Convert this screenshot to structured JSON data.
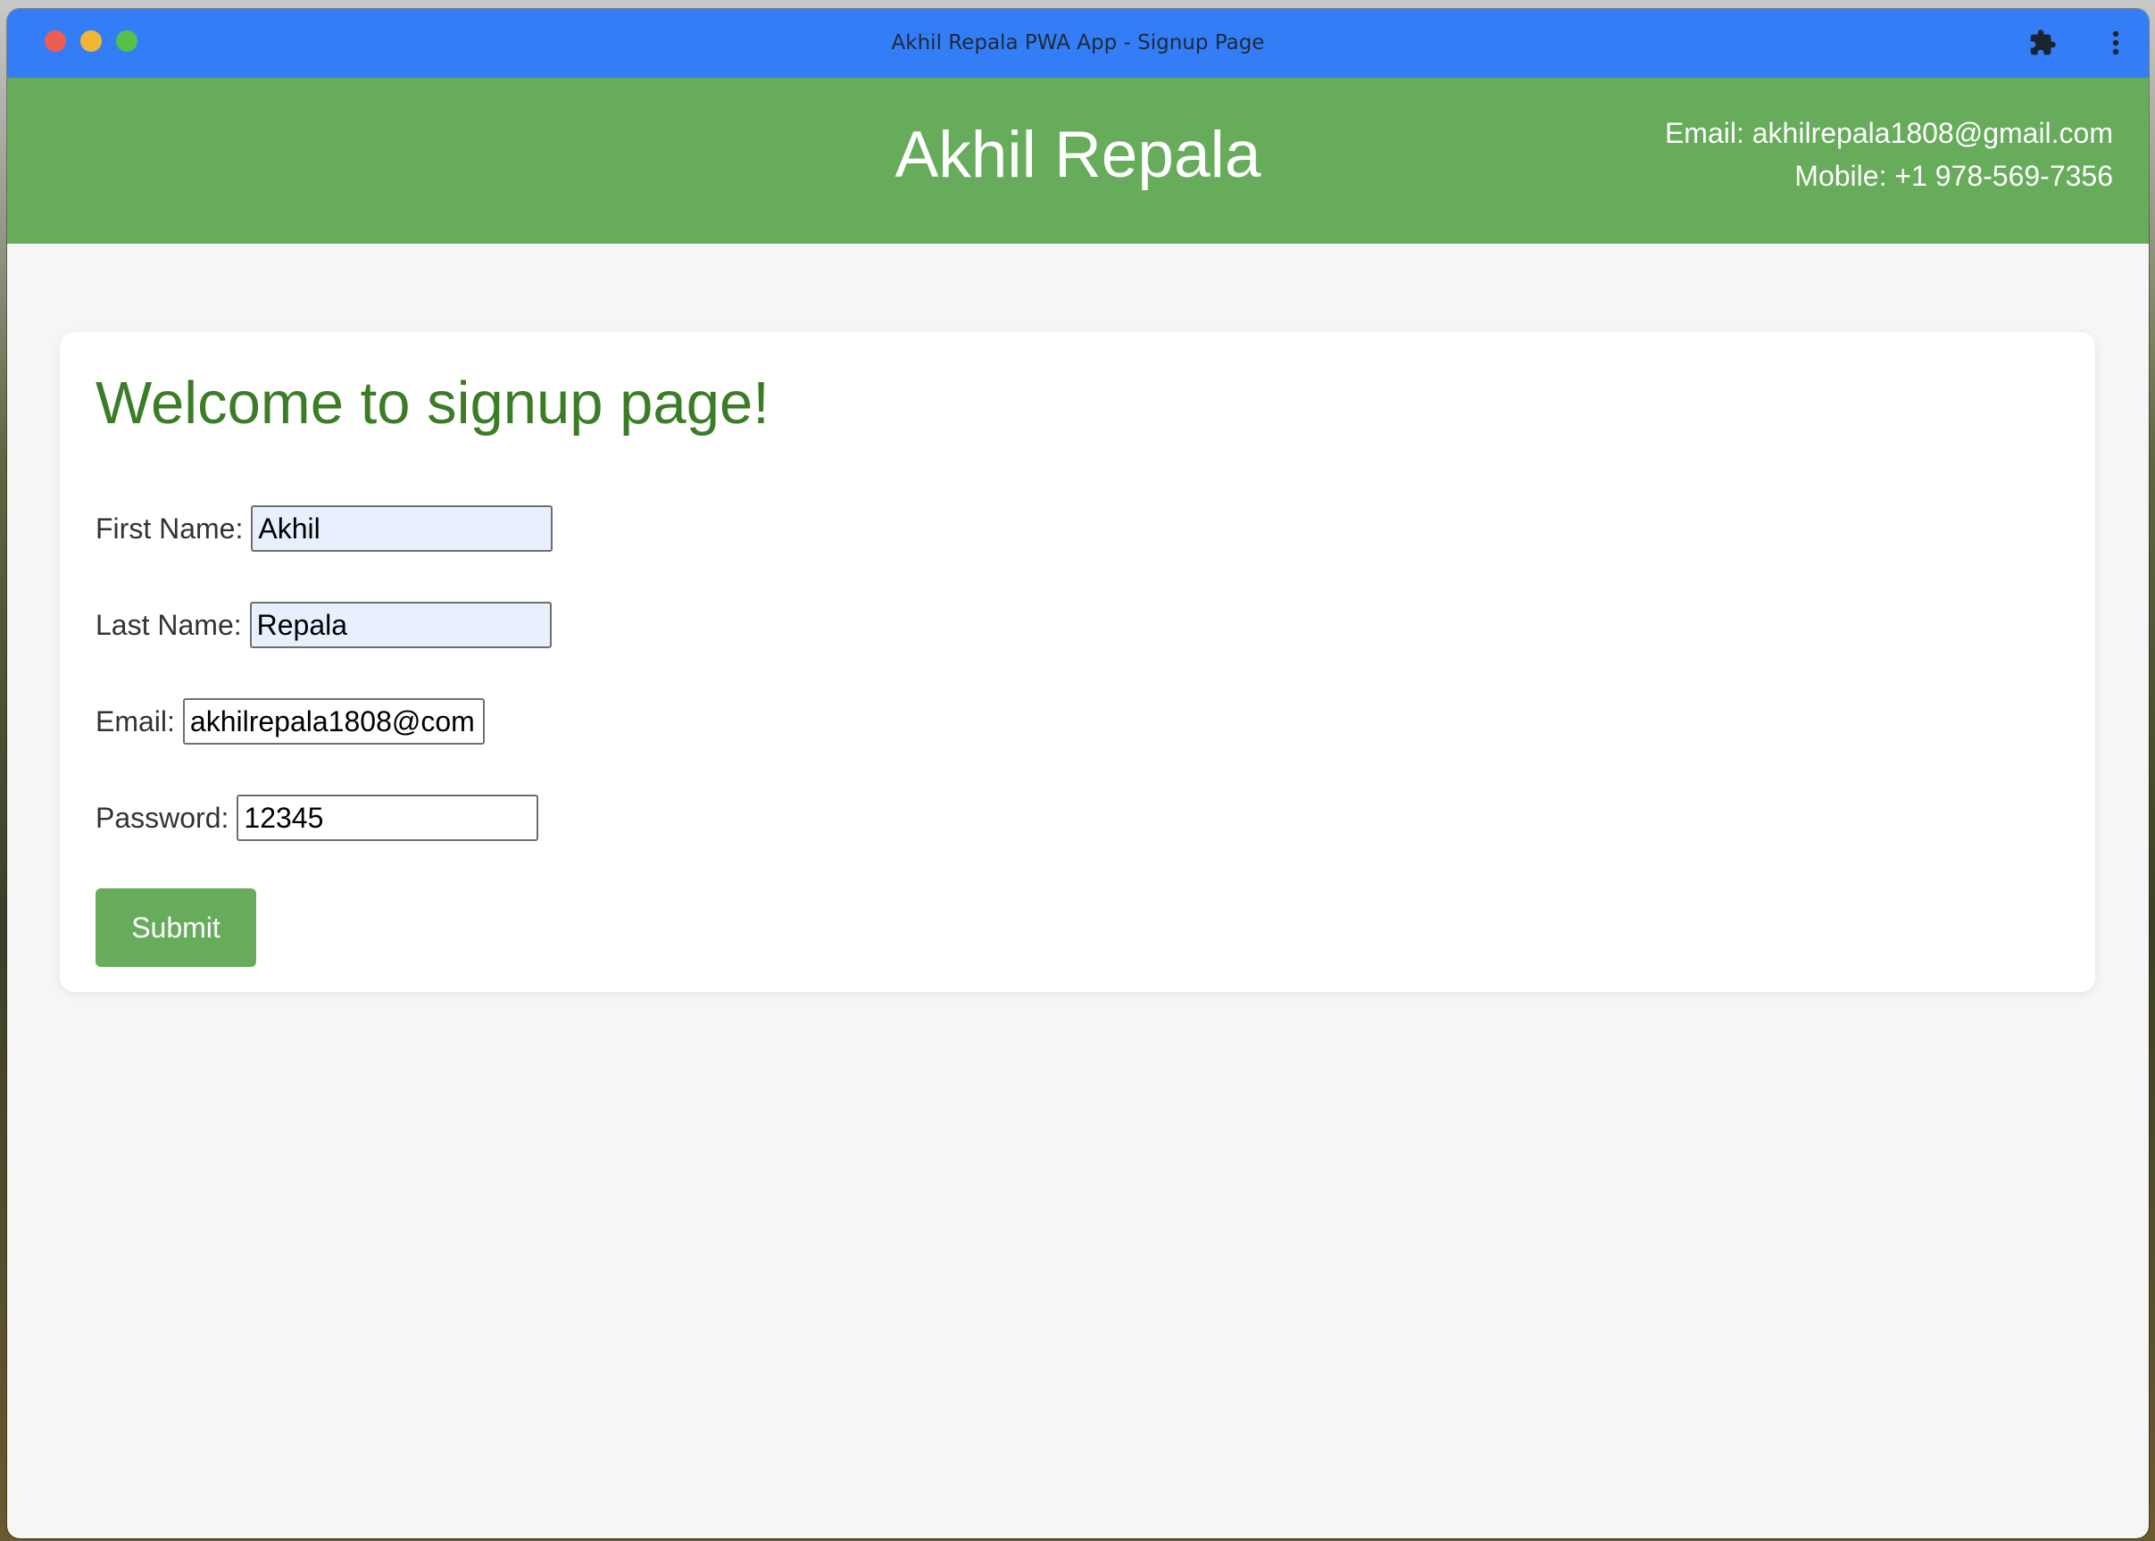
{
  "window": {
    "title": "Akhil Repala PWA App - Signup Page",
    "titlebar_color": "#337ef6"
  },
  "toolbar": {
    "extensions_icon": "puzzle-icon",
    "menu_icon": "more-vert-icon"
  },
  "header": {
    "brand": "Akhil Repala",
    "email_line": "Email: akhilrepala1808@gmail.com",
    "mobile_line": "Mobile: +1 978-569-7356",
    "background_color": "#67ac5b"
  },
  "form": {
    "heading": "Welcome to signup page!",
    "heading_color": "#3b7d27",
    "fields": {
      "first_name": {
        "label": "First Name:",
        "value": "Akhil"
      },
      "last_name": {
        "label": "Last Name:",
        "value": "Repala"
      },
      "email": {
        "label": "Email:",
        "value": "akhilrepala1808@com"
      },
      "password": {
        "label": "Password:",
        "value": "12345"
      }
    },
    "submit_label": "Submit"
  }
}
